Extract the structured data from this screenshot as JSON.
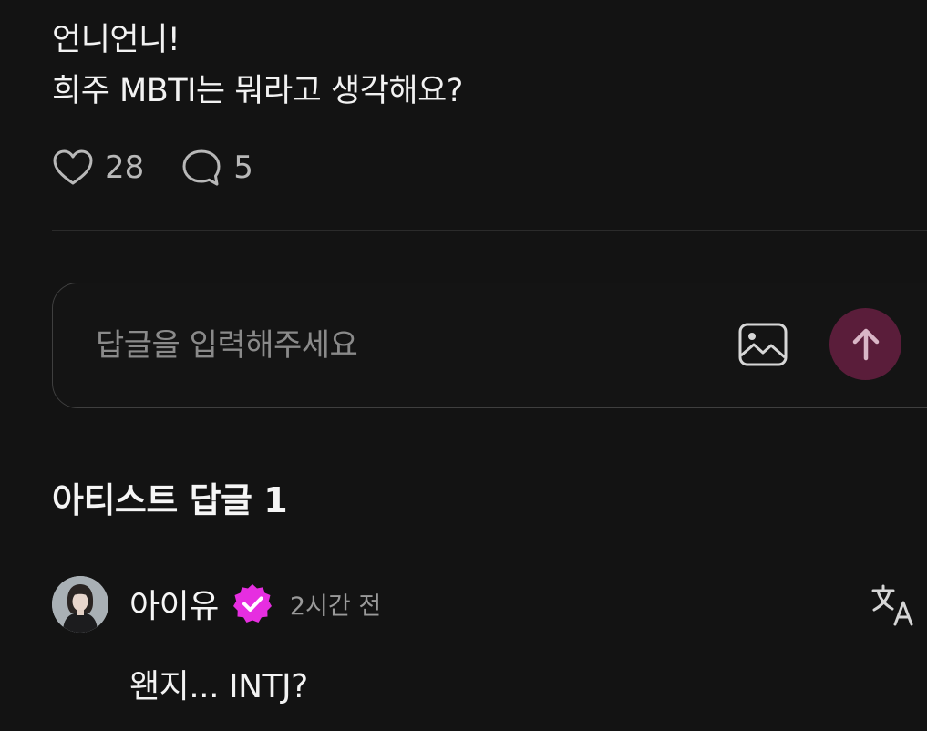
{
  "post": {
    "line1": "언니언니!",
    "line2": "희주 MBTI는 뭐라고 생각해요?"
  },
  "actions": {
    "like_icon": "heart-icon",
    "like_count": "28",
    "comment_icon": "speech-bubble-icon",
    "comment_count": "5"
  },
  "reply_input": {
    "placeholder": "답글을 입력해주세요",
    "image_icon": "image-icon",
    "send_icon": "arrow-up-icon"
  },
  "artist_replies": {
    "title": "아티스트 답글 1",
    "items": [
      {
        "author": "아이유",
        "badge_icon": "verified-badge-icon",
        "time": "2시간 전",
        "text": "왠지... INTJ?",
        "translate_icon": "translate-icon"
      }
    ]
  },
  "colors": {
    "background": "#131313",
    "send_button": "#5a1d3a",
    "verified_badge": "#e62ee0"
  }
}
